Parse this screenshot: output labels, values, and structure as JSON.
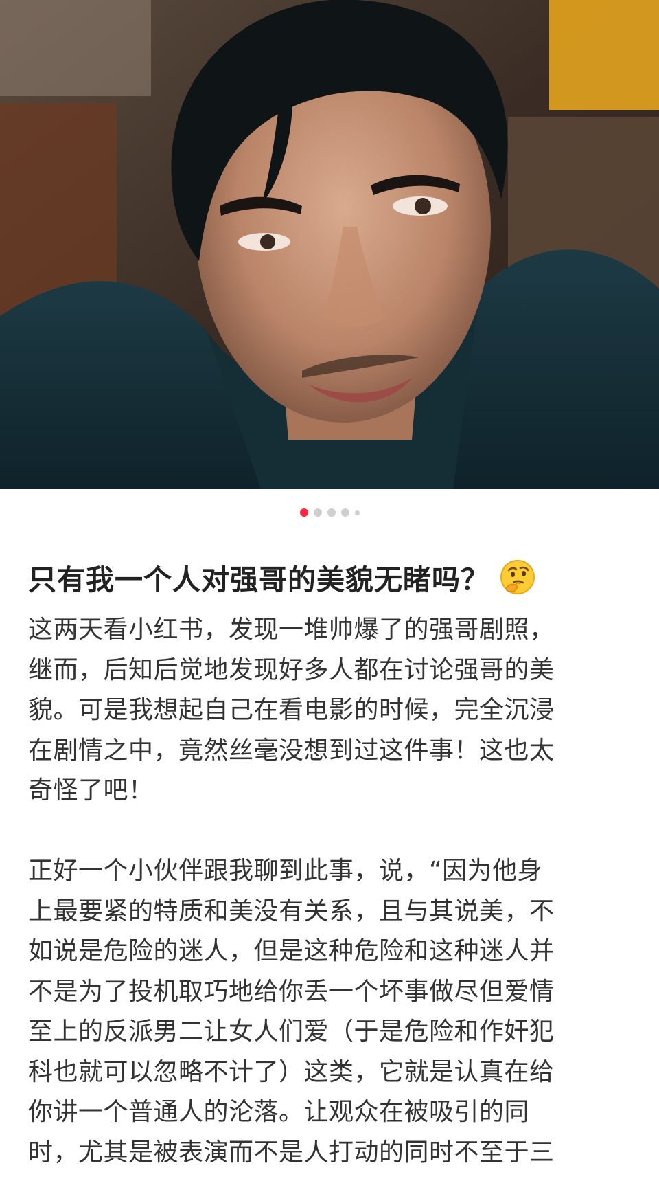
{
  "carousel": {
    "total": 5,
    "active_index": 0
  },
  "post": {
    "title": "只有我一个人对强哥的美貌无睹吗？",
    "title_emoji": "thinking-face-icon",
    "paragraphs": [
      {
        "lines": [
          "这两天看小红书，发现一堆帅爆了的强哥剧照，",
          "继而，后知后觉地发现好多人都在讨论强哥的美",
          "貌。可是我想起自己在看电影的时候，完全沉浸",
          "在剧情之中，竟然丝毫没想到过这件事！这也太",
          "奇怪了吧！"
        ]
      },
      {
        "lines": [
          "正好一个小伙伴跟我聊到此事，说，“因为他身",
          "上最要紧的特质和美没有关系，且与其说美，不",
          "如说是危险的迷人，但是这种危险和这种迷人并",
          "不是为了投机取巧地给你丢一个坏事做尽但爱情",
          "至上的反派男二让女人们爱（于是危险和作奸犯",
          "科也就可以忽略不计了）这类，它就是认真在给",
          "你讲一个普通人的沦落。让观众在被吸引的同",
          "时，尤其是被表演而不是人打动的同时不至于三"
        ]
      }
    ]
  },
  "colors": {
    "accent": "#ff2442",
    "dot_inactive": "#cfcfcf",
    "title_text": "#222222",
    "body_text": "#333333"
  }
}
